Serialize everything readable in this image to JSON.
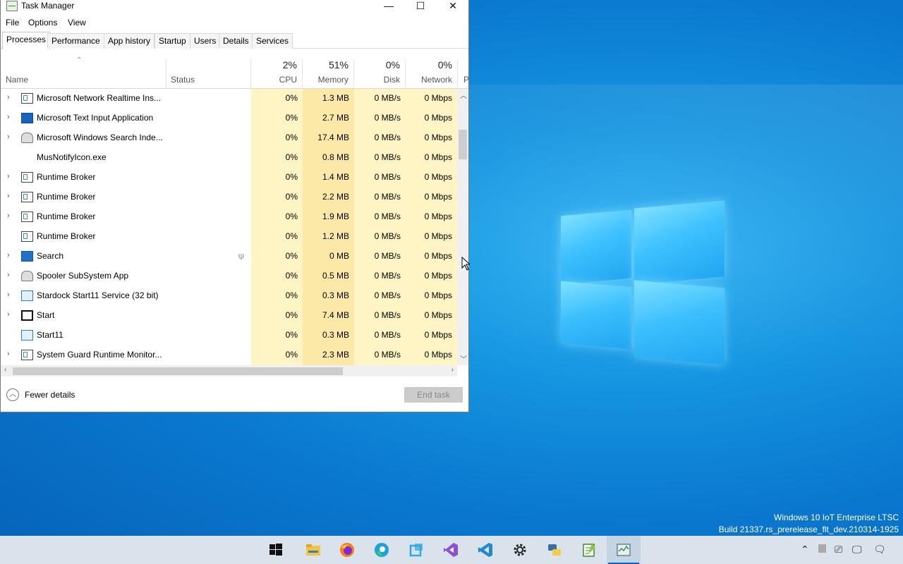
{
  "window": {
    "title": "Task Manager",
    "minimize": "—",
    "maximize": "☐",
    "close": "✕"
  },
  "menu": [
    "File",
    "Options",
    "View"
  ],
  "tabs": [
    "Processes",
    "Performance",
    "App history",
    "Startup",
    "Users",
    "Details",
    "Services"
  ],
  "columns": {
    "name": "Name",
    "status": "Status",
    "cpu": {
      "pct": "2%",
      "label": "CPU"
    },
    "memory": {
      "pct": "51%",
      "label": "Memory"
    },
    "disk": {
      "pct": "0%",
      "label": "Disk"
    },
    "network": {
      "pct": "0%",
      "label": "Network"
    },
    "power": "P"
  },
  "processes": [
    {
      "name": "Microsoft Network Realtime Ins...",
      "cpu": "0%",
      "memory": "1.3 MB",
      "disk": "0 MB/s",
      "network": "0 Mbps",
      "expandable": true,
      "icon": "service-icon"
    },
    {
      "name": "Microsoft Text Input Application",
      "cpu": "0%",
      "memory": "2.7 MB",
      "disk": "0 MB/s",
      "network": "0 Mbps",
      "expandable": true,
      "icon": "text-input-icon"
    },
    {
      "name": "Microsoft Windows Search Inde...",
      "cpu": "0%",
      "memory": "17.4 MB",
      "disk": "0 MB/s",
      "network": "0 Mbps",
      "expandable": true,
      "icon": "search-indexer-icon"
    },
    {
      "name": "MusNotifyIcon.exe",
      "cpu": "0%",
      "memory": "0.8 MB",
      "disk": "0 MB/s",
      "network": "0 Mbps",
      "expandable": false,
      "icon": "blank-icon"
    },
    {
      "name": "Runtime Broker",
      "cpu": "0%",
      "memory": "1.4 MB",
      "disk": "0 MB/s",
      "network": "0 Mbps",
      "expandable": true,
      "icon": "service-icon"
    },
    {
      "name": "Runtime Broker",
      "cpu": "0%",
      "memory": "2.2 MB",
      "disk": "0 MB/s",
      "network": "0 Mbps",
      "expandable": true,
      "icon": "service-icon"
    },
    {
      "name": "Runtime Broker",
      "cpu": "0%",
      "memory": "1.9 MB",
      "disk": "0 MB/s",
      "network": "0 Mbps",
      "expandable": true,
      "icon": "service-icon"
    },
    {
      "name": "Runtime Broker",
      "cpu": "0%",
      "memory": "1.2 MB",
      "disk": "0 MB/s",
      "network": "0 Mbps",
      "expandable": false,
      "icon": "service-icon"
    },
    {
      "name": "Search",
      "cpu": "0%",
      "memory": "0 MB",
      "disk": "0 MB/s",
      "network": "0 Mbps",
      "expandable": true,
      "icon": "search-icon",
      "status_icon": "leaf-icon"
    },
    {
      "name": "Spooler SubSystem App",
      "cpu": "0%",
      "memory": "0.5 MB",
      "disk": "0 MB/s",
      "network": "0 Mbps",
      "expandable": true,
      "icon": "printer-icon"
    },
    {
      "name": "Stardock Start11 Service (32 bit)",
      "cpu": "0%",
      "memory": "0.3 MB",
      "disk": "0 MB/s",
      "network": "0 Mbps",
      "expandable": true,
      "icon": "start11-icon"
    },
    {
      "name": "Start",
      "cpu": "0%",
      "memory": "7.4 MB",
      "disk": "0 MB/s",
      "network": "0 Mbps",
      "expandable": true,
      "icon": "start-icon"
    },
    {
      "name": "Start11",
      "cpu": "0%",
      "memory": "0.3 MB",
      "disk": "0 MB/s",
      "network": "0 Mbps",
      "expandable": false,
      "icon": "start11-icon"
    },
    {
      "name": "System Guard Runtime Monitor...",
      "cpu": "0%",
      "memory": "2.3 MB",
      "disk": "0 MB/s",
      "network": "0 Mbps",
      "expandable": true,
      "icon": "service-icon"
    }
  ],
  "footer": {
    "fewer_details": "Fewer details",
    "end_task": "End task"
  },
  "watermark": {
    "line1": "Windows 10 IoT Enterprise LTSC",
    "line2": "Build 21337.rs_prerelease_flt_dev.210314-1925"
  },
  "taskbar": {
    "apps": [
      "windows-start-icon",
      "file-explorer-icon",
      "firefox-icon",
      "edge-icon",
      "start11-icon",
      "visual-studio-icon",
      "vscode-icon",
      "settings-gear-icon",
      "python-icon",
      "notepad-plus-icon",
      "task-manager-icon"
    ],
    "active": "task-manager-icon",
    "tray": [
      "chevron-up-icon",
      "tray-app-icon",
      "network-icon",
      "display-icon",
      "notification-icon"
    ]
  },
  "colors": {
    "cpu_bg": "#fff4c4",
    "mem_bg": "#fce9a8",
    "accent": "#0a64c2",
    "desktop": "#0a78cf"
  }
}
